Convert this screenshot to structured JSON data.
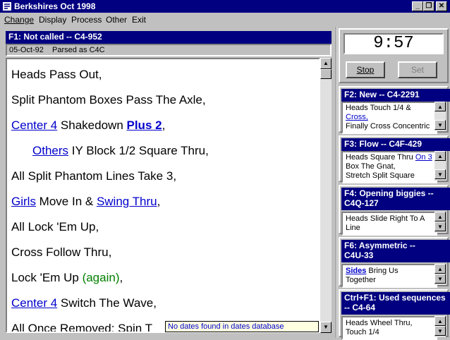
{
  "window": {
    "title": "Berkshires Oct 1998"
  },
  "menu": {
    "change": "Change",
    "display": "Display",
    "process": "Process",
    "other": "Other",
    "exit": "Exit"
  },
  "current": {
    "header": "F1: Not called  --  C4-952",
    "date": "05-Oct-92",
    "parsed": "Parsed as C4C",
    "lines": [
      {
        "a": "Heads Pass Out,"
      },
      {
        "a": "Split Phantom Boxes Pass The Axle,"
      },
      {
        "l1": "Center 4",
        "a": " Shakedown ",
        "b1": "Plus 2",
        "c": ","
      },
      {
        "l1": "Others",
        "a": " IY Block 1/2 Square Thru,"
      },
      {
        "a": "All Split Phantom Lines Take 3,"
      },
      {
        "l1": "Girls",
        "a": " Move In & ",
        "l2": "Swing Thru",
        "c": ","
      },
      {
        "a": "All Lock 'Em Up,"
      },
      {
        "a": "Cross Follow Thru,"
      },
      {
        "a": "Lock 'Em Up ",
        "g": "(again)",
        "c": ","
      },
      {
        "l1": "Center 4",
        "a": " Switch The Wave,"
      },
      {
        "a": "All Once Removed: Spin T"
      }
    ],
    "tooltip": "No dates found in dates database"
  },
  "timer": {
    "value": "9:57",
    "stop": "Stop",
    "set": "Set"
  },
  "queues": [
    {
      "header": "F2: New  --  C4-2291",
      "lines": [
        "Heads Touch 1/4 &",
        "Cross,",
        "Finally Cross Concentric"
      ]
    },
    {
      "header": "F3: Flow  --  C4F-429",
      "lines": [
        "Heads Square Thru ",
        "On 3",
        "Box The Gnat,",
        "Stretch Split Square"
      ]
    },
    {
      "header1": "F4: Opening biggies  --",
      "header2": "C4Q-127",
      "lines": [
        "Heads Slide Right To A",
        "Line"
      ]
    },
    {
      "header1": "F6: Asymmetric  --",
      "header2": "C4U-33",
      "lines": [
        "Sides",
        " Bring Us",
        "Together"
      ]
    },
    {
      "header1": "Ctrl+F1: Used sequences",
      "header2": "--  C4-64",
      "lines": [
        "Heads Wheel Thru,",
        "Touch 1/4"
      ]
    }
  ],
  "icons": {
    "app": "app-icon",
    "minimize": "minimize-icon",
    "maximize": "restore-icon",
    "close": "close-icon"
  }
}
